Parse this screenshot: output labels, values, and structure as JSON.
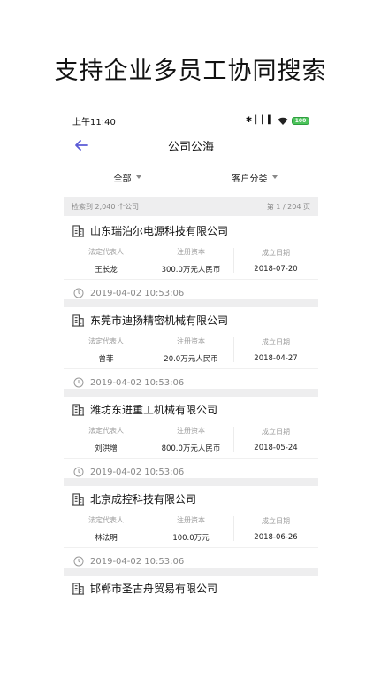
{
  "headline": "支持企业多员工协同搜索",
  "status": {
    "time": "上午11:40",
    "battery": "100"
  },
  "nav": {
    "title": "公司公海"
  },
  "filters": {
    "all": "全部",
    "category": "客户分类"
  },
  "summary": {
    "count_text": "检索到 2,040 个公司",
    "page_text": "第 1 / 204 页"
  },
  "labels": {
    "legal_rep": "法定代表人",
    "capital": "注册资本",
    "founded": "成立日期"
  },
  "companies": [
    {
      "name": "山东瑞泊尔电源科技有限公司",
      "legal_rep": "王长龙",
      "capital": "300.0万元人民币",
      "founded": "2018-07-20",
      "time": "2019-04-02 10:53:06"
    },
    {
      "name": "东莞市迪扬精密机械有限公司",
      "legal_rep": "曾菲",
      "capital": "20.0万元人民币",
      "founded": "2018-04-27",
      "time": "2019-04-02 10:53:06"
    },
    {
      "name": "潍坊东进重工机械有限公司",
      "legal_rep": "刘洪增",
      "capital": "800.0万元人民币",
      "founded": "2018-05-24",
      "time": "2019-04-02 10:53:06"
    },
    {
      "name": "北京成控科技有限公司",
      "legal_rep": "林法明",
      "capital": "100.0万元",
      "founded": "2018-06-26",
      "time": "2019-04-02 10:53:06"
    },
    {
      "name": "邯郸市圣古舟贸易有限公司"
    }
  ],
  "colors": {
    "accent": "#5b5bd6",
    "divider": "#eeeeef",
    "muted": "#888888"
  },
  "icons": {
    "back": "arrow-left-icon",
    "company": "building-icon",
    "time": "clock-icon"
  }
}
